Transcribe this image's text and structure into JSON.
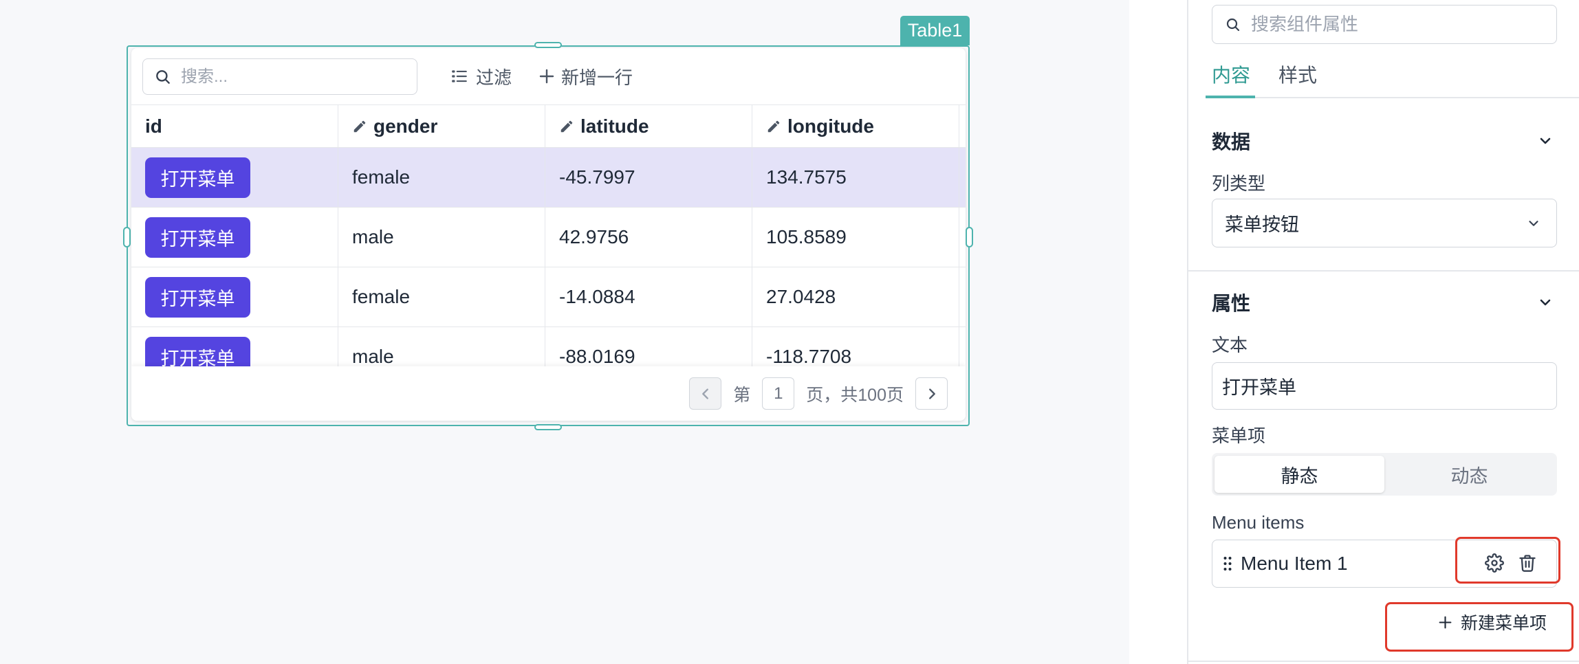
{
  "colors": {
    "accent": "#4db3ad",
    "accent_text": "#2f9a92",
    "menu_button": "#5444e0",
    "selected_row": "#e4e2f8",
    "highlight": "#e0392b"
  },
  "canvas": {
    "widget_tag": "Table1",
    "table": {
      "search_placeholder": "搜索...",
      "filter_label": "过滤",
      "add_row_label": "新增一行",
      "columns": [
        {
          "label": "id",
          "editable": false
        },
        {
          "label": "gender",
          "editable": true
        },
        {
          "label": "latitude",
          "editable": true
        },
        {
          "label": "longitude",
          "editable": true
        }
      ],
      "rows": [
        {
          "menu_label": "打开菜单",
          "gender": "female",
          "latitude": "-45.7997",
          "longitude": "134.7575",
          "selected": true
        },
        {
          "menu_label": "打开菜单",
          "gender": "male",
          "latitude": "42.9756",
          "longitude": "105.8589",
          "selected": false
        },
        {
          "menu_label": "打开菜单",
          "gender": "female",
          "latitude": "-14.0884",
          "longitude": "27.0428",
          "selected": false
        },
        {
          "menu_label": "打开菜单",
          "gender": "male",
          "latitude": "-88.0169",
          "longitude": "-118.7708",
          "selected": false
        }
      ],
      "pagination": {
        "prefix": "第",
        "current_page": "1",
        "suffix": "页，共100页",
        "prev_disabled": true
      }
    }
  },
  "panel": {
    "search_placeholder": "搜索组件属性",
    "tabs": [
      {
        "label": "内容",
        "active": true
      },
      {
        "label": "样式",
        "active": false
      }
    ],
    "data_section": {
      "title": "数据",
      "column_type_label": "列类型",
      "column_type_value": "菜单按钮"
    },
    "props_section": {
      "title": "属性",
      "text_label": "文本",
      "text_value": "打开菜单",
      "menu_items_label": "菜单项",
      "source_options": [
        {
          "label": "静态",
          "active": true
        },
        {
          "label": "动态",
          "active": false
        }
      ],
      "menu_items_title": "Menu items",
      "menu_items": [
        {
          "label": "Menu Item 1"
        }
      ],
      "add_menu_item_label": "新建菜单项"
    }
  }
}
